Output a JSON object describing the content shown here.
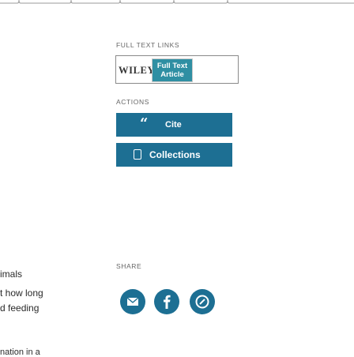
{
  "full_text": {
    "heading": "FULL TEXT LINKS",
    "publisher": "WILEY",
    "badge_line1": "Full Text",
    "badge_line2": "Article"
  },
  "actions": {
    "heading": "ACTIONS",
    "cite_label": "Cite",
    "collections_label": "Collections"
  },
  "share": {
    "heading": "SHARE",
    "buttons": [
      "email-icon",
      "facebook-icon",
      "share-icon"
    ]
  },
  "left_content": {
    "line1": "imals",
    "line2": "t how long",
    "line3": "d feeding",
    "line4": "nation in a"
  },
  "colors": {
    "accent": "#1d6f93",
    "badge": "#2f8fa3"
  }
}
